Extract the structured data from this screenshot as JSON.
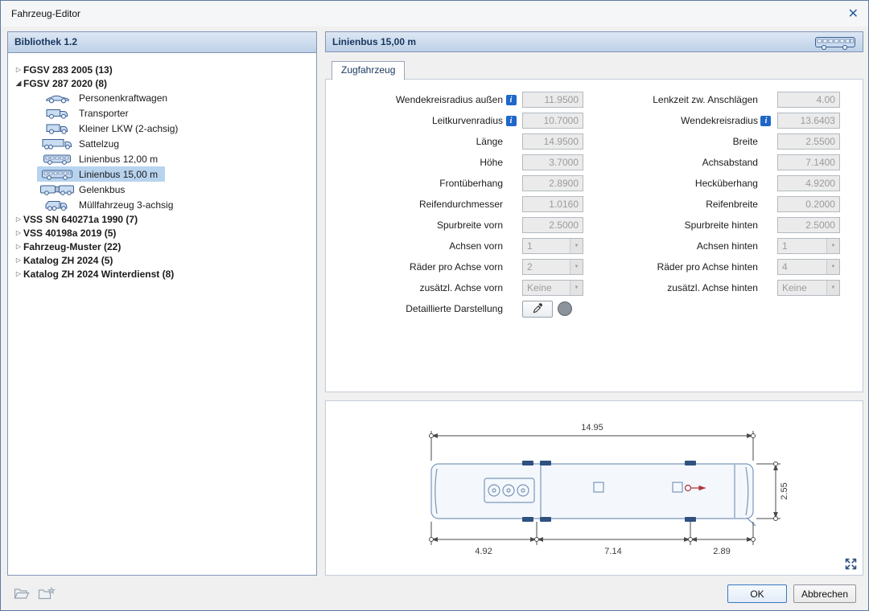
{
  "window": {
    "title": "Fahrzeug-Editor"
  },
  "icons": {
    "collapsed": "▷",
    "expanded": "◢",
    "dropdown": "▼",
    "close": "✕",
    "info": "i"
  },
  "colors": {
    "panel_header_top": "#dde7f4",
    "panel_header_bottom": "#bed1e8",
    "panel_border": "#8296b5",
    "selection": "#b8d3ee",
    "info_icon_blue": "#1f67c9",
    "marker_red": "#b23038"
  },
  "library": {
    "header": "Bibliothek 1.2",
    "tree": [
      {
        "label": "FGSV 283 2005 (13)"
      },
      {
        "label": "FGSV 287 2020 (8)"
      },
      {
        "label": "Personenkraftwagen"
      },
      {
        "label": "Transporter"
      },
      {
        "label": "Kleiner LKW (2-achsig)"
      },
      {
        "label": "Sattelzug"
      },
      {
        "label": "Linienbus 12,00 m"
      },
      {
        "label": "Linienbus 15,00 m"
      },
      {
        "label": "Gelenkbus"
      },
      {
        "label": "Müllfahrzeug 3-achsig"
      },
      {
        "label": "VSS SN 640271a 1990 (7)"
      },
      {
        "label": "VSS 40198a 2019 (5)"
      },
      {
        "label": "Fahrzeug-Muster (22)"
      },
      {
        "label": "Katalog ZH 2024 (5)"
      },
      {
        "label": "Katalog ZH 2024 Winterdienst (8)"
      }
    ]
  },
  "editor": {
    "header": "Linienbus 15,00 m",
    "tab": "Zugfahrzeug"
  },
  "form": {
    "left": [
      {
        "label": "Wendekreisradius außen",
        "value": "11.9500"
      },
      {
        "label": "Leitkurvenradius",
        "value": "10.7000"
      },
      {
        "label": "Länge",
        "value": "14.9500"
      },
      {
        "label": "Höhe",
        "value": "3.7000"
      },
      {
        "label": "Frontüberhang",
        "value": "2.8900"
      },
      {
        "label": "Reifendurchmesser",
        "value": "1.0160"
      },
      {
        "label": "Spurbreite vorn",
        "value": "2.5000"
      },
      {
        "label": "Achsen vorn",
        "value": "1"
      },
      {
        "label": "Räder pro Achse vorn",
        "value": "2"
      },
      {
        "label": "zusätzl. Achse vorn",
        "value": "Keine"
      },
      {
        "label": "Detaillierte Darstellung"
      }
    ],
    "right": [
      {
        "label": "Lenkzeit zw. Anschlägen",
        "value": "4.00"
      },
      {
        "label": "Wendekreisradius",
        "value": "13.6403"
      },
      {
        "label": "Breite",
        "value": "2.5500"
      },
      {
        "label": "Achsabstand",
        "value": "7.1400"
      },
      {
        "label": "Hecküberhang",
        "value": "4.9200"
      },
      {
        "label": "Reifenbreite",
        "value": "0.2000"
      },
      {
        "label": "Spurbreite hinten",
        "value": "2.5000"
      },
      {
        "label": "Achsen hinten",
        "value": "1"
      },
      {
        "label": "Räder pro Achse hinten",
        "value": "4"
      },
      {
        "label": "zusätzl. Achse hinten",
        "value": "Keine"
      }
    ]
  },
  "diagram": {
    "total_length": "14.95",
    "rear_overhang": "4.92",
    "wheelbase": "7.14",
    "front_overhang": "2.89",
    "width": "2.55"
  },
  "footer": {
    "ok": "OK",
    "cancel": "Abbrechen"
  }
}
